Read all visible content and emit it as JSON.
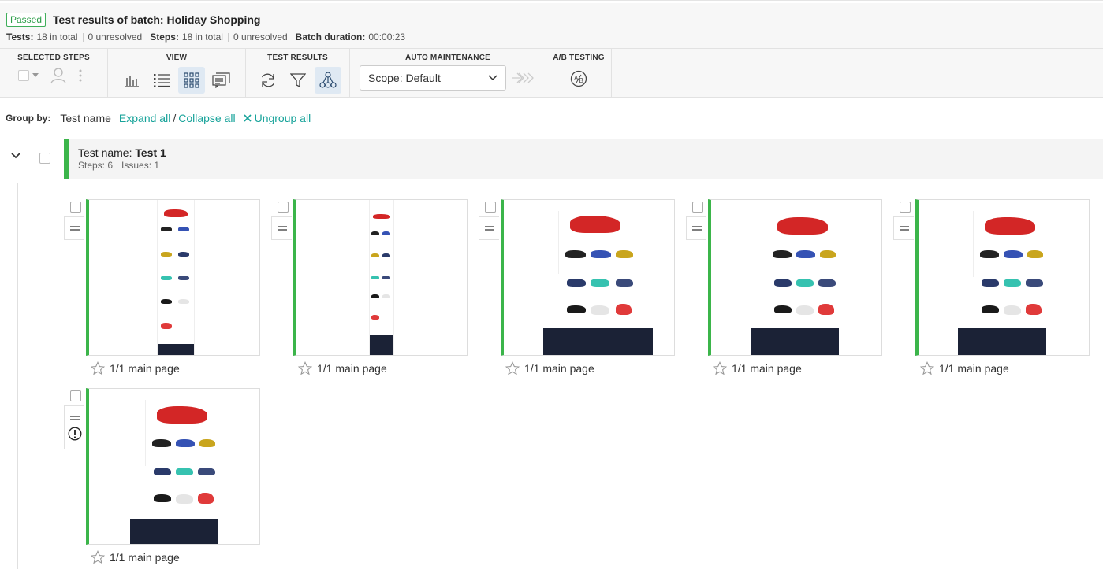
{
  "header": {
    "status_badge": "Passed",
    "title": "Test results of batch: Holiday Shopping",
    "tests_label": "Tests:",
    "tests_total": "18 in total",
    "tests_unresolved": "0 unresolved",
    "steps_label": "Steps:",
    "steps_total": "18 in total",
    "steps_unresolved": "0 unresolved",
    "duration_label": "Batch duration:",
    "duration_value": "00:00:23"
  },
  "toolbar": {
    "selected_steps_label": "SELECTED STEPS",
    "view_label": "VIEW",
    "test_results_label": "TEST RESULTS",
    "auto_maintenance_label": "AUTO MAINTENANCE",
    "scope_value": "Scope: Default",
    "ab_testing_label": "A/B TESTING"
  },
  "group_by": {
    "label": "Group by:",
    "value": "Test name",
    "expand_all": "Expand all",
    "separator": "/",
    "collapse_all": "Collapse all",
    "ungroup_all": "Ungroup all"
  },
  "test_group": {
    "name_label": "Test name:",
    "name_value": "Test 1",
    "steps": "Steps: 6",
    "issues": "Issues: 1"
  },
  "steps": [
    {
      "caption": "1/1 main page"
    },
    {
      "caption": "1/1 main page"
    },
    {
      "caption": "1/1 main page"
    },
    {
      "caption": "1/1 main page"
    },
    {
      "caption": "1/1 main page"
    },
    {
      "caption": "1/1 main page"
    }
  ],
  "colors": {
    "accent_green": "#3bb54a",
    "link_teal": "#17a39a",
    "active_bg": "#dfe9f3",
    "footer_navy": "#1b2236"
  }
}
